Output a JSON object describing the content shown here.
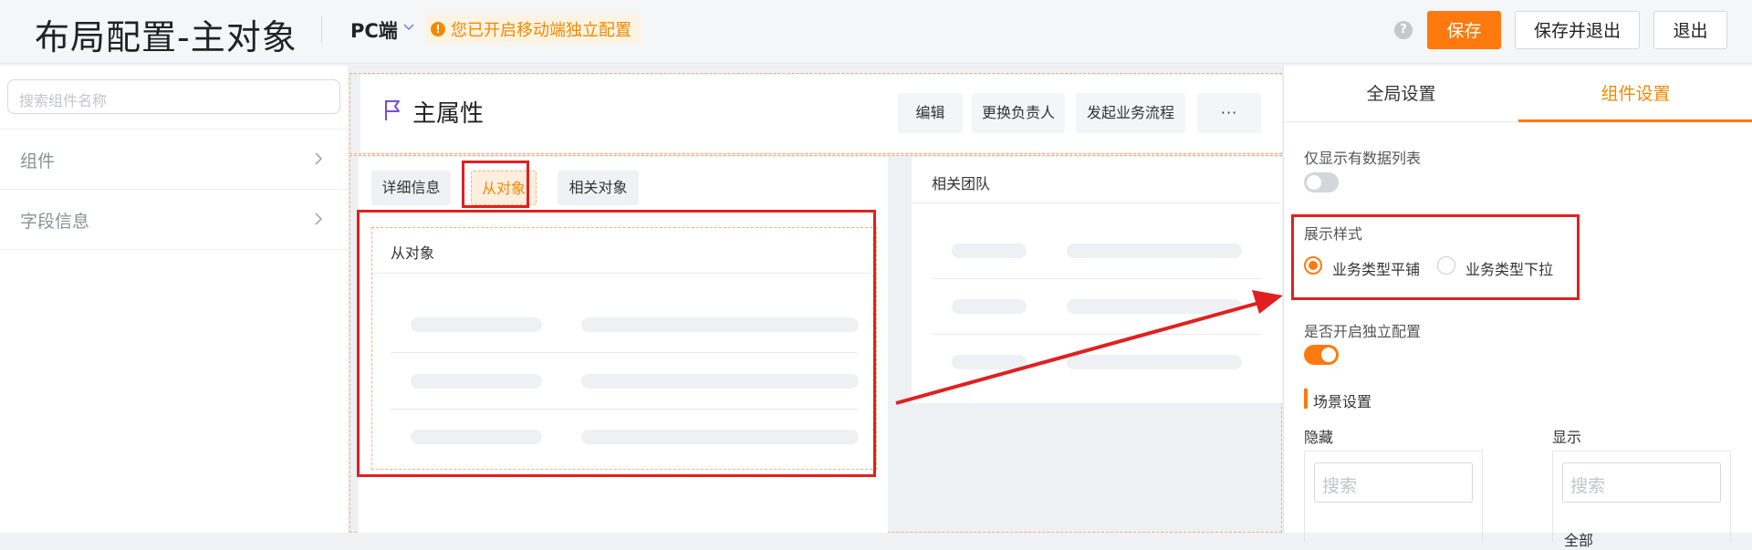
{
  "header": {
    "title": "布局配置-主对象",
    "platform": "PC端",
    "notice": "您已开启移动端独立配置",
    "help": "?",
    "save": "保存",
    "save_exit": "保存并退出",
    "exit": "退出"
  },
  "sidebar": {
    "search_placeholder": "搜索组件名称",
    "items": [
      {
        "label": "组件"
      },
      {
        "label": "字段信息"
      }
    ]
  },
  "canvas": {
    "main_title": "主属性",
    "actions": [
      "编辑",
      "更换负责人",
      "发起业务流程",
      "···"
    ],
    "tabs": [
      "详细信息",
      "从对象",
      "相关对象"
    ],
    "sub_title": "从对象",
    "team_title": "相关团队"
  },
  "rpanel": {
    "tabs": [
      "全局设置",
      "组件设置"
    ],
    "only_data_list": "仅显示有数据列表",
    "display_style": "展示样式",
    "radio_options": [
      "业务类型平铺",
      "业务类型下拉"
    ],
    "independent_config": "是否开启独立配置",
    "scene_settings": "场景设置",
    "hidden_label": "隐藏",
    "shown_label": "显示",
    "search_placeholder": "搜索",
    "shown_first_item": "全部"
  },
  "colors": {
    "accent": "#ff7a0e",
    "annotation": "#e02020"
  }
}
